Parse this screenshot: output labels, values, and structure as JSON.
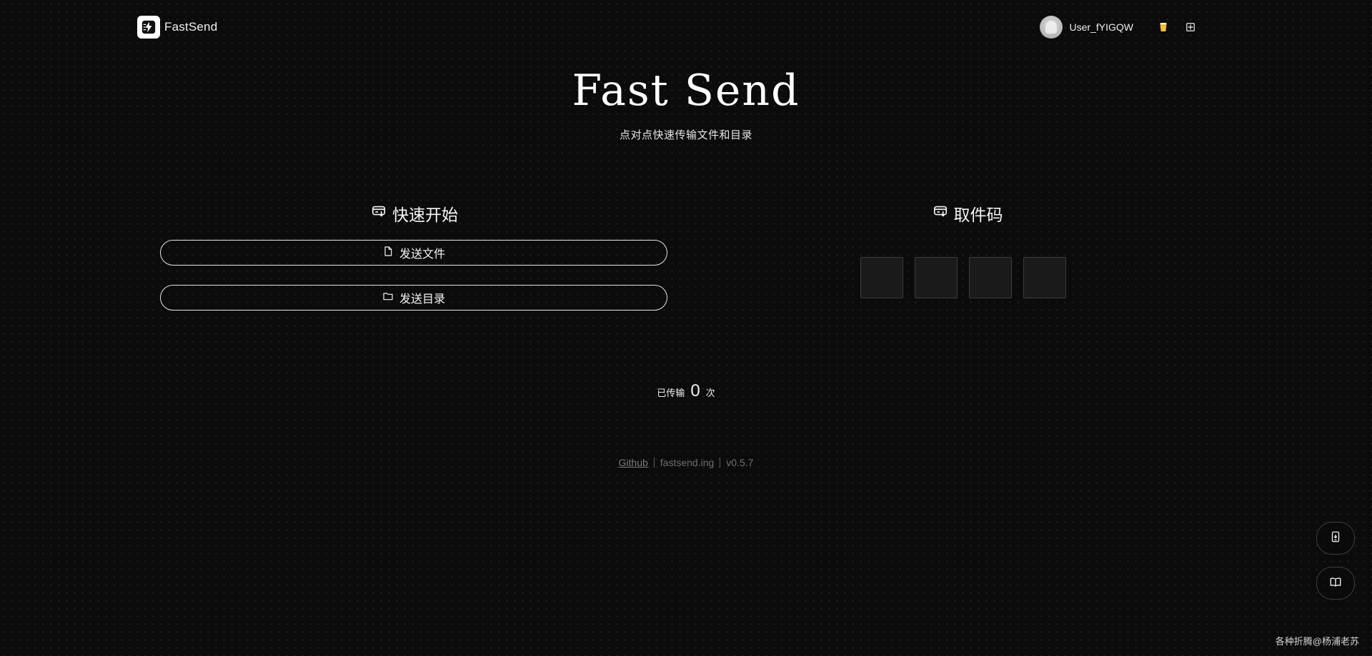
{
  "header": {
    "brand_name": "FastSend",
    "user_name": "User_fYIGQW",
    "icons": [
      "fastsend-logo-icon",
      "avatar",
      "beer-icon",
      "qr-icon"
    ]
  },
  "hero": {
    "title": "Fast Send",
    "subtitle": "点对点快速传输文件和目录"
  },
  "quick_start": {
    "title": "快速开始",
    "send_file_label": "发送文件",
    "send_dir_label": "发送目录"
  },
  "pickup_code": {
    "title": "取件码",
    "boxes": [
      "",
      "",
      "",
      ""
    ]
  },
  "stats": {
    "prefix": "已传输",
    "count": "0",
    "suffix": "次"
  },
  "footer": {
    "github": "Github",
    "site": "fastsend.ing",
    "version": "v0.5.7"
  },
  "credit": "各种折腾@杨浦老苏",
  "colors": {
    "background": "#0b0b0c",
    "text": "#f3f3f3",
    "muted": "#6f6f73",
    "border": "#e6e6e6",
    "code_box_bg": "#1a1a1b"
  }
}
